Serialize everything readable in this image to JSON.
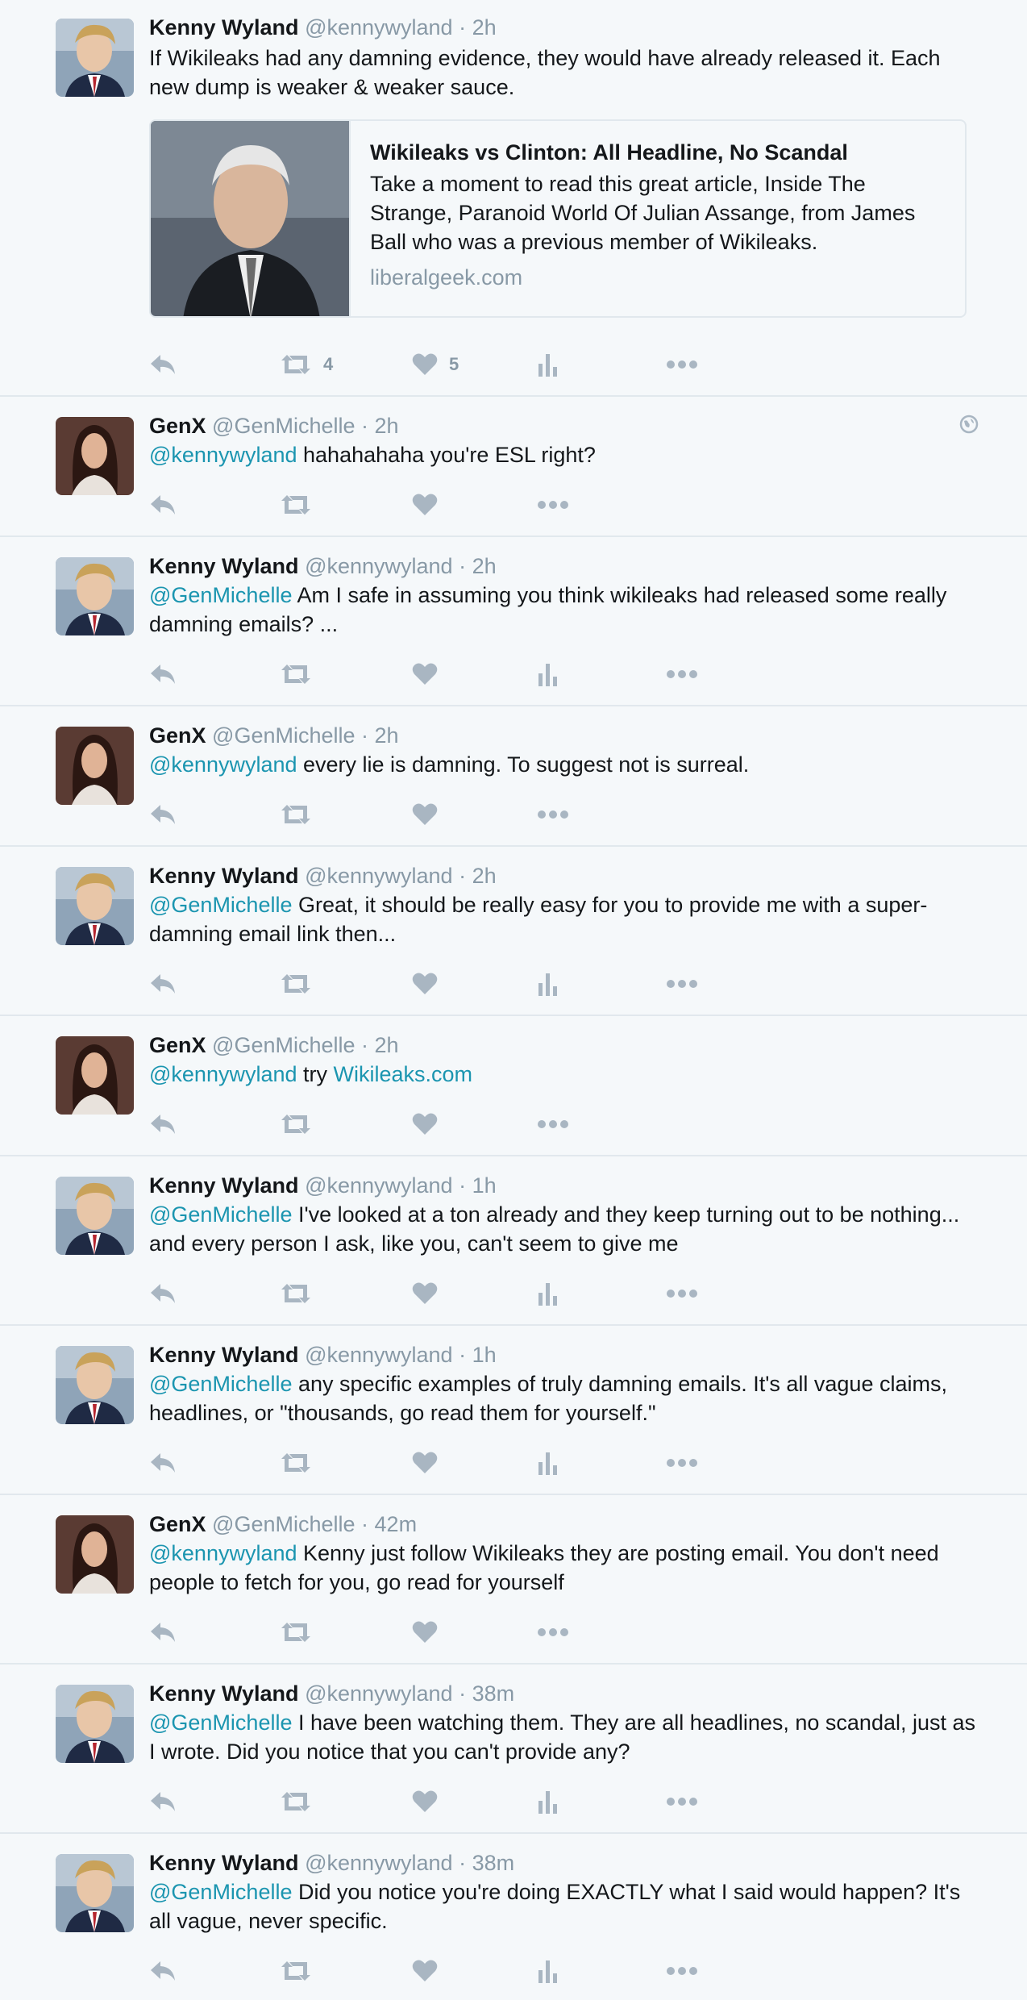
{
  "tweets": [
    {
      "name": "Kenny Wyland",
      "handle": "@kennywyland",
      "time": "2h",
      "text_mention": "",
      "text": "If Wikileaks had any damning evidence, they would have already released it. Each new dump is weaker & weaker sauce.",
      "card": {
        "title": "Wikileaks vs Clinton: All Headline, No Scandal",
        "description": "Take a moment to read this great article, Inside The Strange, Paranoid World Of Julian Assange, from James Ball who was a previous member of Wikileaks.",
        "domain": "liberalgeek.com"
      },
      "retweet_count": "4",
      "like_count": "5"
    },
    {
      "name": "GenX",
      "handle": "@GenMichelle",
      "time": "2h",
      "text_mention": "@kennywyland",
      "text": " hahahahaha you're ESL right?"
    },
    {
      "name": "Kenny Wyland",
      "handle": "@kennywyland",
      "time": "2h",
      "text_mention": "@GenMichelle",
      "text": " Am I safe in assuming you think wikileaks had released some really damning emails? ..."
    },
    {
      "name": "GenX",
      "handle": "@GenMichelle",
      "time": "2h",
      "text_mention": "@kennywyland",
      "text": " every lie is damning. To suggest not is surreal."
    },
    {
      "name": "Kenny Wyland",
      "handle": "@kennywyland",
      "time": "2h",
      "text_mention": "@GenMichelle",
      "text": " Great, it should be really easy for you to provide me with a super-damning email link then..."
    },
    {
      "name": "GenX",
      "handle": "@GenMichelle",
      "time": "2h",
      "text_mention": "@kennywyland",
      "text": " try ",
      "text_link": "Wikileaks.com"
    },
    {
      "name": "Kenny Wyland",
      "handle": "@kennywyland",
      "time": "1h",
      "text_mention": "@GenMichelle",
      "text": " I've looked at a ton already and they keep turning out to be nothing... and every person I ask, like you, can't seem to give me"
    },
    {
      "name": "Kenny Wyland",
      "handle": "@kennywyland",
      "time": "1h",
      "text_mention": "@GenMichelle",
      "text": " any specific examples of truly damning emails. It's all vague claims, headlines, or \"thousands, go read them for yourself.\""
    },
    {
      "name": "GenX",
      "handle": "@GenMichelle",
      "time": "42m",
      "text_mention": "@kennywyland",
      "text": " Kenny just follow Wikileaks they are posting email. You don't need people to fetch for you, go read for yourself"
    },
    {
      "name": "Kenny Wyland",
      "handle": "@kennywyland",
      "time": "38m",
      "text_mention": "@GenMichelle",
      "text": " I have been watching them. They are all headlines, no scandal, just as I wrote. Did you notice that you can't provide any?"
    },
    {
      "name": "Kenny Wyland",
      "handle": "@kennywyland",
      "time": "38m",
      "text_mention": "@GenMichelle",
      "text": " Did you notice you're doing EXACTLY what I said would happen? It's all vague, never specific."
    }
  ],
  "separator": " · ",
  "colors": {
    "background": "#f5f8fa",
    "link": "#1b95b0",
    "meta": "#8899a6",
    "icon": "#a9b6c2",
    "border": "#e1e8ed"
  },
  "icons": [
    "reply-icon",
    "retweet-icon",
    "heart-icon",
    "analytics-icon",
    "more-icon",
    "globe-icon"
  ]
}
